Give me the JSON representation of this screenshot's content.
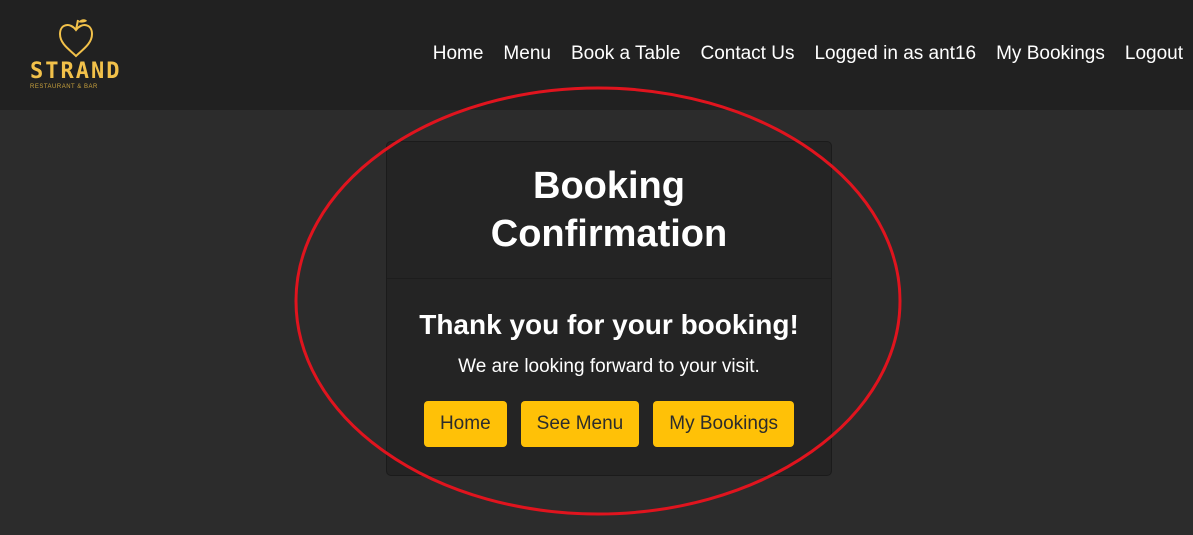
{
  "brand": {
    "name": "STRAND",
    "tagline": "RESTAURANT & BAR",
    "logo_icon": "apple-heart-icon",
    "color": "#f2c14a"
  },
  "nav": {
    "items": [
      {
        "label": "Home"
      },
      {
        "label": "Menu"
      },
      {
        "label": "Book a Table"
      },
      {
        "label": "Contact Us"
      },
      {
        "label": "Logged in as ant16"
      },
      {
        "label": "My Bookings"
      },
      {
        "label": "Logout"
      }
    ]
  },
  "card": {
    "title": "Booking Confirmation",
    "heading": "Thank you for your booking!",
    "message": "We are looking forward to your visit.",
    "buttons": [
      {
        "label": "Home"
      },
      {
        "label": "See Menu"
      },
      {
        "label": "My Bookings"
      }
    ]
  },
  "colors": {
    "page_bg": "#2c2c2c",
    "navbar_bg": "#212121",
    "card_bg": "#242424",
    "button_bg": "#ffc107",
    "annotation": "#e0141e"
  }
}
